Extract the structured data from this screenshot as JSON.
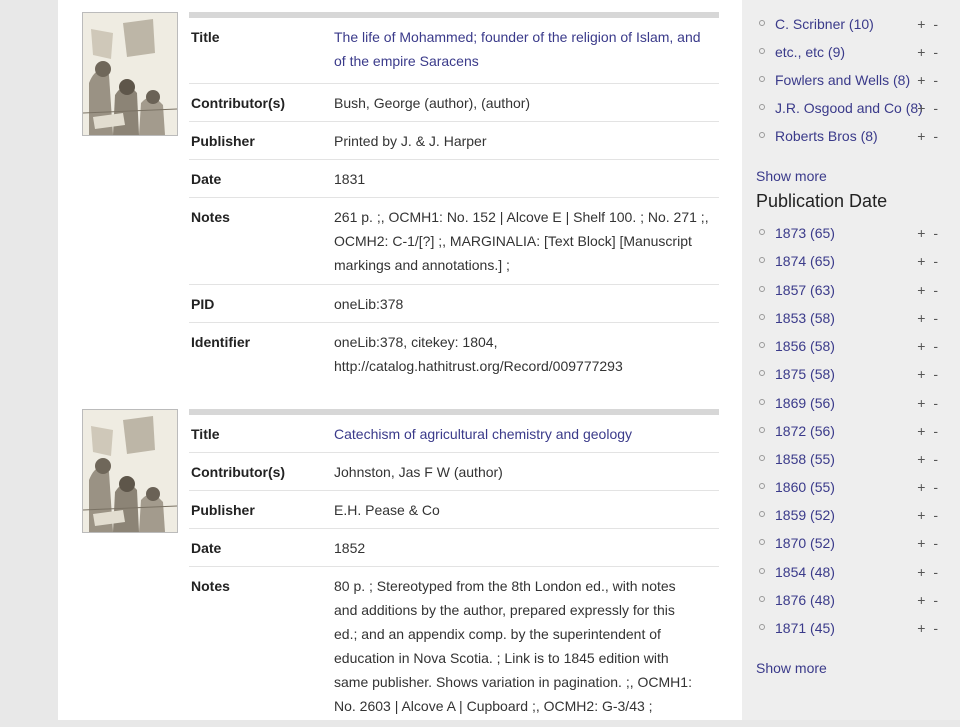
{
  "records": [
    {
      "fields": [
        {
          "label": "Title",
          "value": "The life of Mohammed; founder of the religion of Islam, and of the empire Saracens"
        },
        {
          "label": "Contributor(s)",
          "value": "Bush, George (author), (author)"
        },
        {
          "label": "Publisher",
          "value": "Printed by J. & J. Harper"
        },
        {
          "label": "Date",
          "value": "1831"
        },
        {
          "label": "Notes",
          "value": "261 p. ;, OCMH1: No. 152 | Alcove E | Shelf 100. ; No. 271 ;, OCMH2: C-1/[?] ;, MARGINALIA: [Text Block] [Manuscript markings and annotations.] ;"
        },
        {
          "label": "PID",
          "value": "oneLib:378"
        },
        {
          "label": "Identifier",
          "value": "oneLib:378, citekey: 1804, http://catalog.hathitrust.org/Record/009777293"
        }
      ]
    },
    {
      "fields": [
        {
          "label": "Title",
          "value": "Catechism of agricultural chemistry and geology"
        },
        {
          "label": "Contributor(s)",
          "value": "Johnston, Jas F W (author)"
        },
        {
          "label": "Publisher",
          "value": "E.H. Pease & Co"
        },
        {
          "label": "Date",
          "value": "1852"
        },
        {
          "label": "Notes",
          "value": "80 p. ; Stereotyped from the 8th London ed., with notes and additions by the author, prepared expressly for this ed.; and an appendix comp. by the superintendent of education in Nova Scotia. ; Link is to 1845 edition with same publisher. Shows variation in pagination. ;, OCMH1: No. 2603 | Alcove A | Cupboard ;, OCMH2: G-3/43 ;"
        }
      ]
    }
  ],
  "sidebar": {
    "publishers": [
      {
        "label": "C. Scribner (10)"
      },
      {
        "label": "etc., etc (9)"
      },
      {
        "label": "Fowlers and Wells (8)"
      },
      {
        "label": "J.R. Osgood and Co (8)"
      },
      {
        "label": "Roberts Bros (8)"
      }
    ],
    "publishers_show_more": "Show more",
    "pubdate_heading": "Publication Date",
    "pubdates": [
      {
        "label": "1873 (65)"
      },
      {
        "label": "1874 (65)"
      },
      {
        "label": "1857 (63)"
      },
      {
        "label": "1853 (58)"
      },
      {
        "label": "1856 (58)"
      },
      {
        "label": "1875 (58)"
      },
      {
        "label": "1869 (56)"
      },
      {
        "label": "1872 (56)"
      },
      {
        "label": "1858 (55)"
      },
      {
        "label": "1860 (55)"
      },
      {
        "label": "1859 (52)"
      },
      {
        "label": "1870 (52)"
      },
      {
        "label": "1854 (48)"
      },
      {
        "label": "1876 (48)"
      },
      {
        "label": "1871 (45)"
      }
    ],
    "pubdates_show_more": "Show more",
    "plus_minus": "+ -"
  },
  "icons": {
    "thumbnail": "engraving-thumbnail-icon",
    "bullet": "circle-bullet-icon"
  },
  "colors": {
    "link": "#3a3a8a",
    "sidebar_bg": "#eeeeee",
    "page_bg": "#e8e8e8"
  }
}
